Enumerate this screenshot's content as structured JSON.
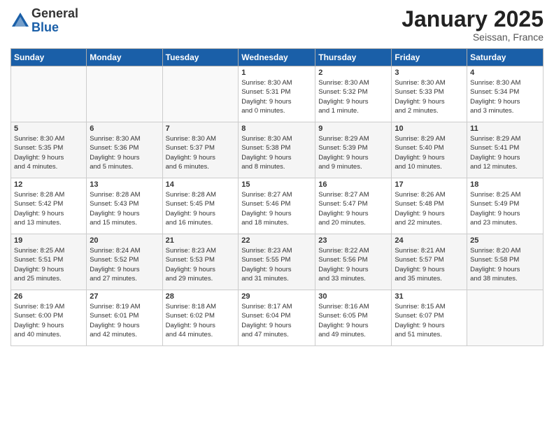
{
  "header": {
    "logo_general": "General",
    "logo_blue": "Blue",
    "month_title": "January 2025",
    "subtitle": "Seissan, France"
  },
  "days_of_week": [
    "Sunday",
    "Monday",
    "Tuesday",
    "Wednesday",
    "Thursday",
    "Friday",
    "Saturday"
  ],
  "weeks": [
    [
      {
        "day": "",
        "info": ""
      },
      {
        "day": "",
        "info": ""
      },
      {
        "day": "",
        "info": ""
      },
      {
        "day": "1",
        "info": "Sunrise: 8:30 AM\nSunset: 5:31 PM\nDaylight: 9 hours\nand 0 minutes."
      },
      {
        "day": "2",
        "info": "Sunrise: 8:30 AM\nSunset: 5:32 PM\nDaylight: 9 hours\nand 1 minute."
      },
      {
        "day": "3",
        "info": "Sunrise: 8:30 AM\nSunset: 5:33 PM\nDaylight: 9 hours\nand 2 minutes."
      },
      {
        "day": "4",
        "info": "Sunrise: 8:30 AM\nSunset: 5:34 PM\nDaylight: 9 hours\nand 3 minutes."
      }
    ],
    [
      {
        "day": "5",
        "info": "Sunrise: 8:30 AM\nSunset: 5:35 PM\nDaylight: 9 hours\nand 4 minutes."
      },
      {
        "day": "6",
        "info": "Sunrise: 8:30 AM\nSunset: 5:36 PM\nDaylight: 9 hours\nand 5 minutes."
      },
      {
        "day": "7",
        "info": "Sunrise: 8:30 AM\nSunset: 5:37 PM\nDaylight: 9 hours\nand 6 minutes."
      },
      {
        "day": "8",
        "info": "Sunrise: 8:30 AM\nSunset: 5:38 PM\nDaylight: 9 hours\nand 8 minutes."
      },
      {
        "day": "9",
        "info": "Sunrise: 8:29 AM\nSunset: 5:39 PM\nDaylight: 9 hours\nand 9 minutes."
      },
      {
        "day": "10",
        "info": "Sunrise: 8:29 AM\nSunset: 5:40 PM\nDaylight: 9 hours\nand 10 minutes."
      },
      {
        "day": "11",
        "info": "Sunrise: 8:29 AM\nSunset: 5:41 PM\nDaylight: 9 hours\nand 12 minutes."
      }
    ],
    [
      {
        "day": "12",
        "info": "Sunrise: 8:28 AM\nSunset: 5:42 PM\nDaylight: 9 hours\nand 13 minutes."
      },
      {
        "day": "13",
        "info": "Sunrise: 8:28 AM\nSunset: 5:43 PM\nDaylight: 9 hours\nand 15 minutes."
      },
      {
        "day": "14",
        "info": "Sunrise: 8:28 AM\nSunset: 5:45 PM\nDaylight: 9 hours\nand 16 minutes."
      },
      {
        "day": "15",
        "info": "Sunrise: 8:27 AM\nSunset: 5:46 PM\nDaylight: 9 hours\nand 18 minutes."
      },
      {
        "day": "16",
        "info": "Sunrise: 8:27 AM\nSunset: 5:47 PM\nDaylight: 9 hours\nand 20 minutes."
      },
      {
        "day": "17",
        "info": "Sunrise: 8:26 AM\nSunset: 5:48 PM\nDaylight: 9 hours\nand 22 minutes."
      },
      {
        "day": "18",
        "info": "Sunrise: 8:25 AM\nSunset: 5:49 PM\nDaylight: 9 hours\nand 23 minutes."
      }
    ],
    [
      {
        "day": "19",
        "info": "Sunrise: 8:25 AM\nSunset: 5:51 PM\nDaylight: 9 hours\nand 25 minutes."
      },
      {
        "day": "20",
        "info": "Sunrise: 8:24 AM\nSunset: 5:52 PM\nDaylight: 9 hours\nand 27 minutes."
      },
      {
        "day": "21",
        "info": "Sunrise: 8:23 AM\nSunset: 5:53 PM\nDaylight: 9 hours\nand 29 minutes."
      },
      {
        "day": "22",
        "info": "Sunrise: 8:23 AM\nSunset: 5:55 PM\nDaylight: 9 hours\nand 31 minutes."
      },
      {
        "day": "23",
        "info": "Sunrise: 8:22 AM\nSunset: 5:56 PM\nDaylight: 9 hours\nand 33 minutes."
      },
      {
        "day": "24",
        "info": "Sunrise: 8:21 AM\nSunset: 5:57 PM\nDaylight: 9 hours\nand 35 minutes."
      },
      {
        "day": "25",
        "info": "Sunrise: 8:20 AM\nSunset: 5:58 PM\nDaylight: 9 hours\nand 38 minutes."
      }
    ],
    [
      {
        "day": "26",
        "info": "Sunrise: 8:19 AM\nSunset: 6:00 PM\nDaylight: 9 hours\nand 40 minutes."
      },
      {
        "day": "27",
        "info": "Sunrise: 8:19 AM\nSunset: 6:01 PM\nDaylight: 9 hours\nand 42 minutes."
      },
      {
        "day": "28",
        "info": "Sunrise: 8:18 AM\nSunset: 6:02 PM\nDaylight: 9 hours\nand 44 minutes."
      },
      {
        "day": "29",
        "info": "Sunrise: 8:17 AM\nSunset: 6:04 PM\nDaylight: 9 hours\nand 47 minutes."
      },
      {
        "day": "30",
        "info": "Sunrise: 8:16 AM\nSunset: 6:05 PM\nDaylight: 9 hours\nand 49 minutes."
      },
      {
        "day": "31",
        "info": "Sunrise: 8:15 AM\nSunset: 6:07 PM\nDaylight: 9 hours\nand 51 minutes."
      },
      {
        "day": "",
        "info": ""
      }
    ]
  ]
}
